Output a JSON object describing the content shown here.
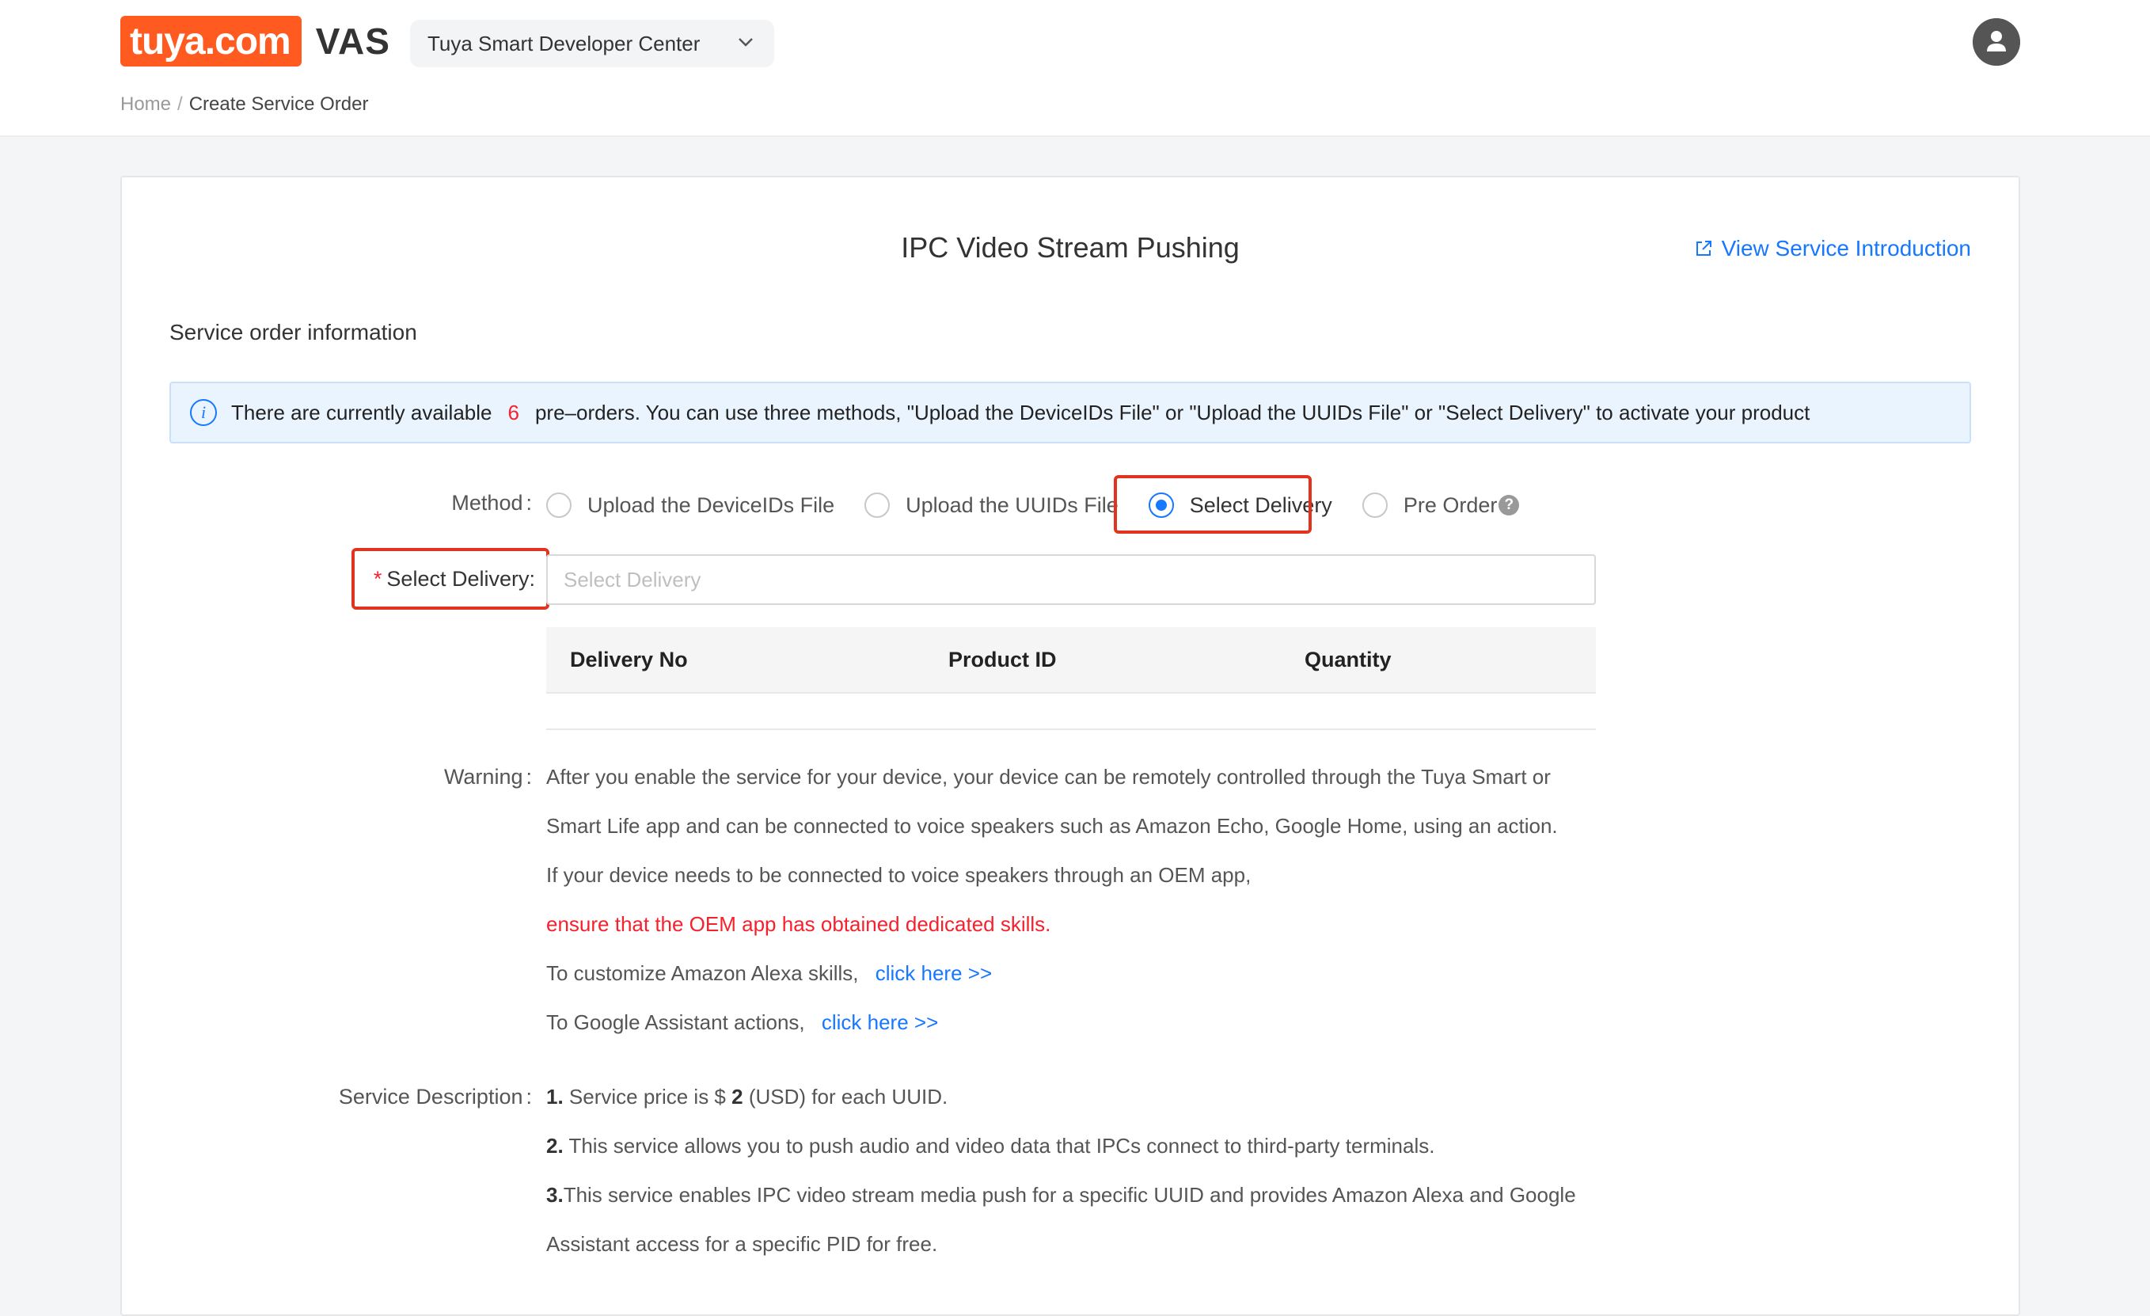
{
  "header": {
    "logo_text": "tuya.com",
    "product": "VAS",
    "center_selector": "Tuya Smart Developer Center"
  },
  "breadcrumb": {
    "home": "Home",
    "separator": "/",
    "current": "Create Service Order"
  },
  "page": {
    "title": "IPC Video Stream Pushing",
    "intro_link": "View Service Introduction",
    "section_title": "Service order information"
  },
  "banner": {
    "prefix": "There are currently available",
    "count": "6",
    "suffix": "pre–orders. You can use three methods, \"Upload the DeviceIDs File\" or \"Upload the UUIDs File\" or \"Select Delivery\" to activate your product"
  },
  "form": {
    "method_label": "Method",
    "methods": [
      {
        "label": "Upload the DeviceIDs File",
        "checked": false
      },
      {
        "label": "Upload the UUIDs File",
        "checked": false
      },
      {
        "label": "Select Delivery",
        "checked": true
      },
      {
        "label": "Pre Order",
        "checked": false
      }
    ],
    "delivery_label": "Select Delivery",
    "delivery_required_mark": "*",
    "delivery_placeholder": "Select Delivery",
    "delivery_value": "",
    "table_columns": [
      "Delivery No",
      "Product ID",
      "Quantity"
    ],
    "table_rows": []
  },
  "warning": {
    "label": "Warning",
    "line1": "After you enable the service for your device, your device can be remotely controlled through the Tuya Smart or",
    "line2": "Smart Life app and can be connected to voice speakers such as Amazon Echo, Google Home, using an action.",
    "line3": "If your device needs to be connected to voice speakers through an OEM app,",
    "line4": "ensure that the OEM app has obtained dedicated skills.",
    "line5_text": "To customize Amazon Alexa skills,",
    "line5_link": "click here >>",
    "line6_text": "To Google Assistant actions,",
    "line6_link": "click here >>"
  },
  "service_description": {
    "label": "Service Description",
    "item1_num": "1.",
    "item1_pre": "Service price is $",
    "item1_price": "2",
    "item1_post": "(USD) for each UUID.",
    "item2_num": "2.",
    "item2": "This service allows you to push audio and video data that IPCs connect to third-party terminals.",
    "item3_num": "3.",
    "item3_line1": "This service enables IPC video stream media push for a specific UUID and provides Amazon Alexa and Google",
    "item3_line2": "Assistant access for a specific PID for free."
  },
  "colors": {
    "brand": "#ff5a1f",
    "link": "#1677ff",
    "highlight_box": "#e0341f",
    "danger_text": "#f5222d"
  }
}
